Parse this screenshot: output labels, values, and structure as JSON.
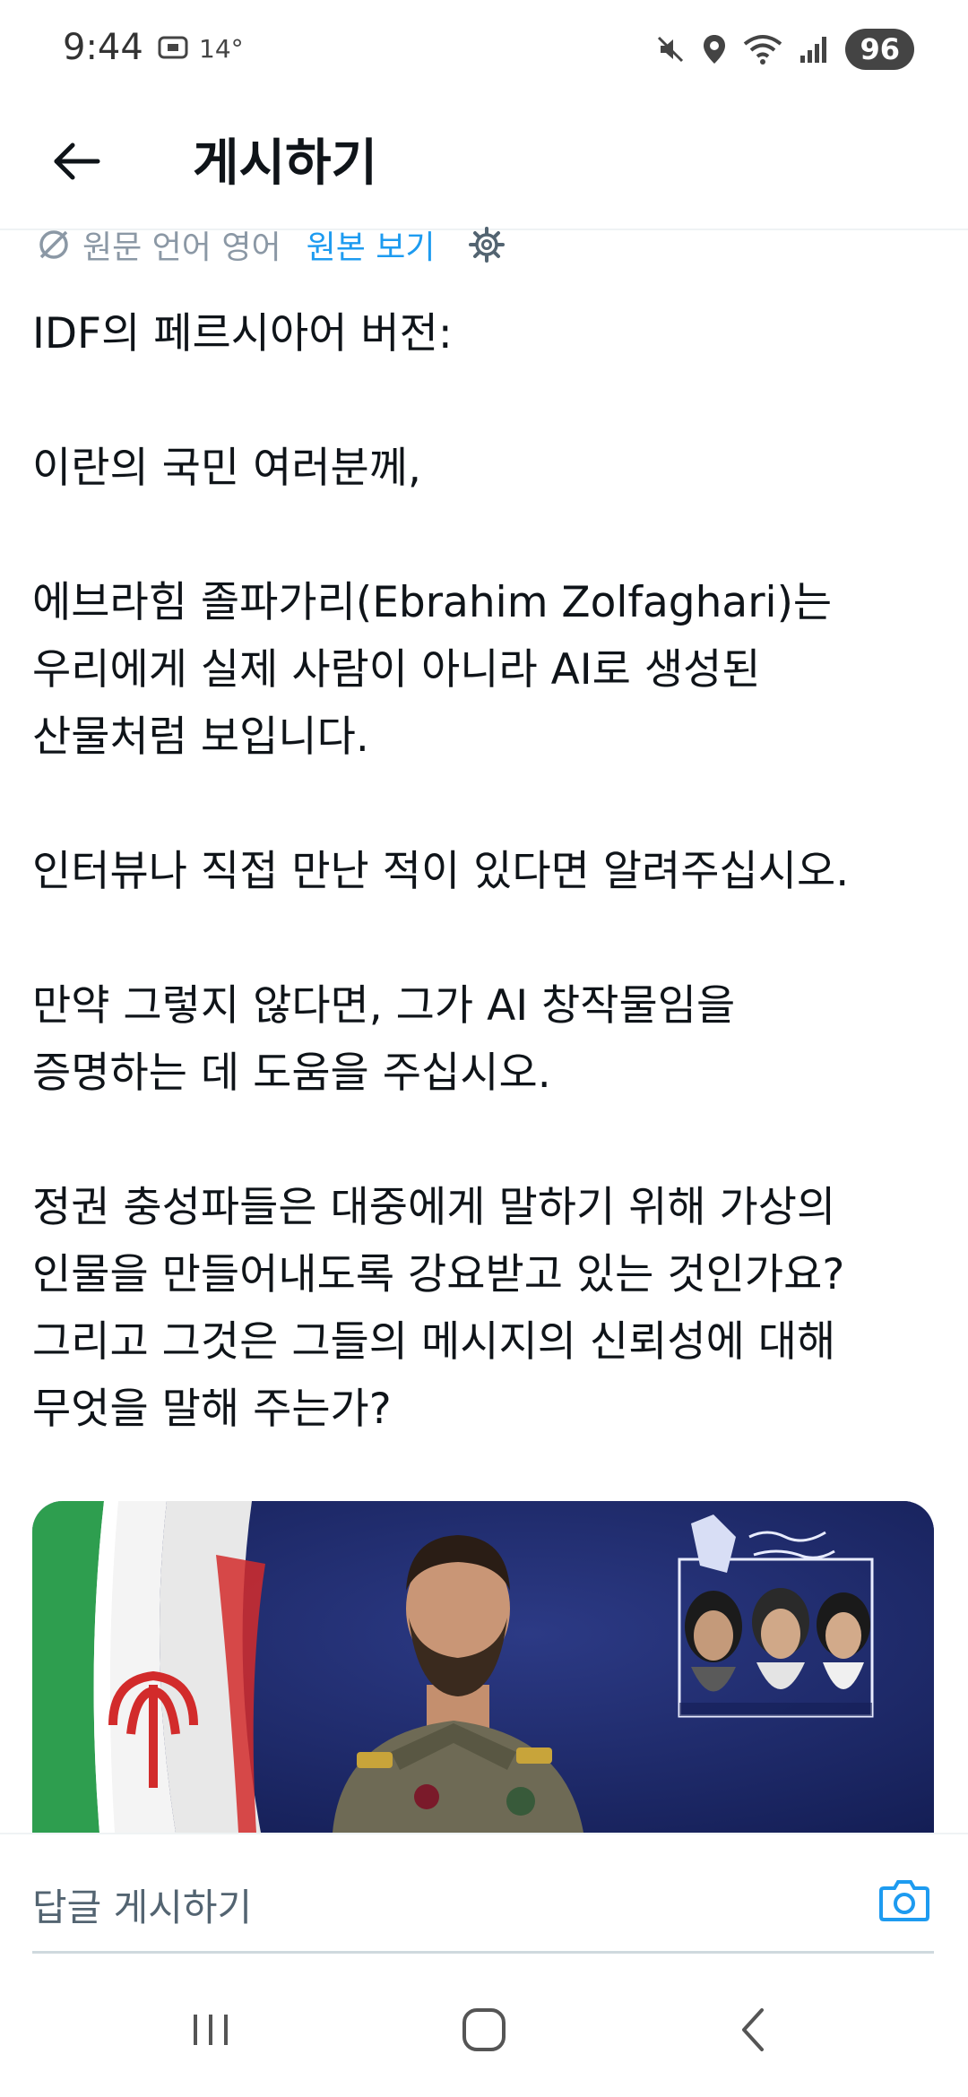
{
  "status_bar": {
    "time": "9:44",
    "temperature": "14°",
    "battery": "96",
    "icons": [
      "screenshot-icon",
      "mute-icon",
      "location-icon",
      "wifi-icon",
      "signal-icon"
    ]
  },
  "header": {
    "title": "게시하기",
    "back_icon": "arrow-left-icon"
  },
  "translation": {
    "label": "원문 언어 영어",
    "link": "원본 보기",
    "icons": [
      "translate-icon",
      "gear-icon"
    ]
  },
  "post": {
    "paragraphs": [
      [
        "IDF의 페르시아어 버전:"
      ],
      [
        "이란의 국민 여러분께,"
      ],
      [
        "에브라힘 졸파가리(Ebrahim Zolfaghari)는",
        "우리에게 실제 사람이 아니라 AI로 생성된",
        "산물처럼 보입니다."
      ],
      [
        "인터뷰나 직접 만난 적이 있다면 알려주십시오."
      ],
      [
        "만약 그렇지 않다면, 그가 AI 창작물임을",
        "증명하는 데 도움을 주십시오."
      ],
      [
        "정권 충성파들은 대중에게 말하기 위해 가상의",
        "인물을 만들어내도록 강요받고 있는 것인가요?",
        "그리고 그것은 그들의 메시지의 신뢰성에 대해",
        "무엇을 말해 주는가?"
      ]
    ]
  },
  "reply": {
    "placeholder": "답글 게시하기",
    "camera_icon": "camera-icon"
  },
  "colors": {
    "accent": "#1d9bf0",
    "muted": "#8b98a5",
    "text": "#0f1419",
    "media_bg": "#1e2a66"
  }
}
